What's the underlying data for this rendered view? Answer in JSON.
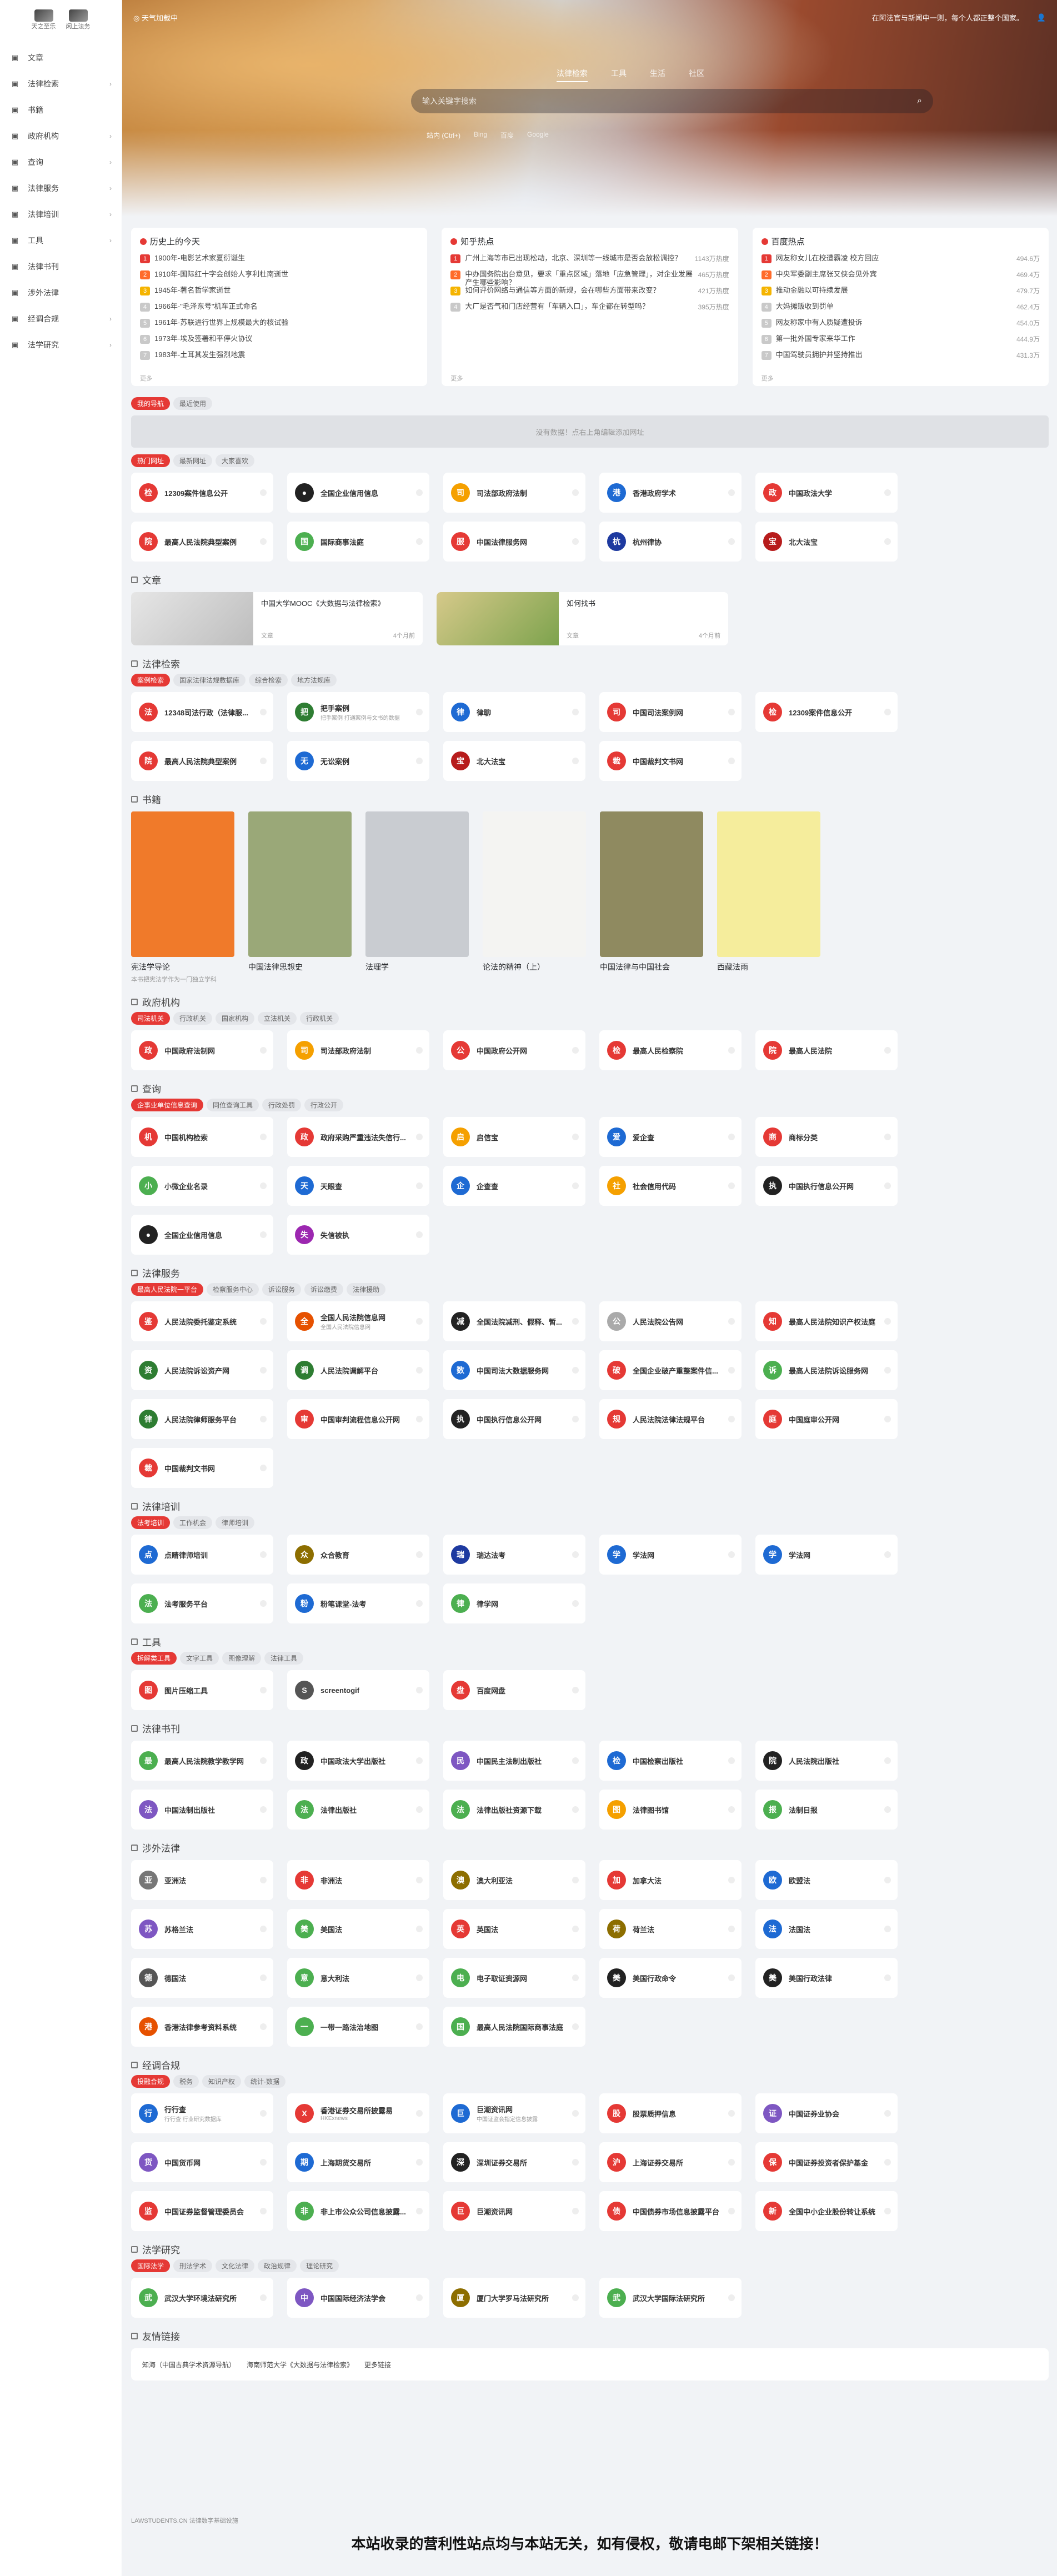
{
  "logo": {
    "left": "天之至乐",
    "right": "闲上法务"
  },
  "sidebar": [
    {
      "label": "文章",
      "icon": "article-icon",
      "chev": false
    },
    {
      "label": "法律检索",
      "icon": "scale-icon",
      "chev": true
    },
    {
      "label": "书籍",
      "icon": "book-icon",
      "chev": false
    },
    {
      "label": "政府机构",
      "icon": "government-icon",
      "chev": true
    },
    {
      "label": "查询",
      "icon": "search-icon",
      "chev": true
    },
    {
      "label": "法律服务",
      "icon": "service-icon",
      "chev": true
    },
    {
      "label": "法律培训",
      "icon": "training-icon",
      "chev": true
    },
    {
      "label": "工具",
      "icon": "tool-icon",
      "chev": true
    },
    {
      "label": "法律书刊",
      "icon": "journal-icon",
      "chev": false
    },
    {
      "label": "涉外法律",
      "icon": "globe-icon",
      "chev": false
    },
    {
      "label": "经调合规",
      "icon": "compliance-icon",
      "chev": true
    },
    {
      "label": "法学研究",
      "icon": "research-icon",
      "chev": true
    }
  ],
  "hero": {
    "tools": [
      "◎ 天气加载中"
    ],
    "news": "在阿法官与新闻中一则，每个人都正整个国家。",
    "tabs": [
      "法律检索",
      "工具",
      "生活",
      "社区"
    ],
    "placeholder": "输入关键字搜索",
    "engines": [
      "站内 (Ctrl+)",
      "Bing",
      "百度",
      "Google"
    ]
  },
  "hot": [
    {
      "title": "历史上的今天",
      "foot": "更多",
      "items": [
        {
          "t": "1900年-电影艺术家夏衍诞生",
          "v": ""
        },
        {
          "t": "1910年-国际红十字会创始人亨利杜南逝世",
          "v": ""
        },
        {
          "t": "1945年-著名哲学家逝世",
          "v": ""
        },
        {
          "t": "1966年-\"毛泽东号\"机车正式命名",
          "v": ""
        },
        {
          "t": "1961年-苏联进行世界上规模最大的核试验",
          "v": ""
        },
        {
          "t": "1973年-埃及签署和平停火协议",
          "v": ""
        },
        {
          "t": "1983年-土耳其发生强烈地震",
          "v": ""
        }
      ]
    },
    {
      "title": "知乎热点",
      "foot": "更多",
      "items": [
        {
          "t": "广州上海等市已出现松动，北京、深圳等一线城市是否会放松调控？",
          "v": "1143万热度"
        },
        {
          "t": "中办国务院出台意见，要求「重点区域」落地「应急管理」，对企业发展产生哪些影响？",
          "v": "465万热度"
        },
        {
          "t": "如何评价网络与通信等方面的新规，会在哪些方面带来改变？",
          "v": "421万热度"
        },
        {
          "t": "大厂是否气和门店经营有「车辆入口」，车企都在转型吗？",
          "v": "395万热度"
        }
      ]
    },
    {
      "title": "百度热点",
      "foot": "更多",
      "items": [
        {
          "t": "网友称女儿在校遭霸凌 校方回应",
          "v": "494.6万"
        },
        {
          "t": "中央军委副主席张又侠会见外宾",
          "v": "469.4万"
        },
        {
          "t": "推动金融以可持续发展",
          "v": "479.7万"
        },
        {
          "t": "大妈摊贩收到罚单",
          "v": "462.4万"
        },
        {
          "t": "网友称家中有人质疑遭投诉",
          "v": "454.0万"
        },
        {
          "t": "第一批外国专家来华工作",
          "v": "444.9万"
        },
        {
          "t": "中国驾驶员拥护并坚持推出",
          "v": "431.3万"
        }
      ]
    }
  ],
  "myNav": {
    "tabs": [
      "我的导航",
      "最近使用"
    ],
    "empty": "没有数据！点右上角编辑添加网址",
    "side": "编辑"
  },
  "hotSites": {
    "tabs": [
      "热门网址",
      "最新网址",
      "大家喜欢"
    ],
    "items": [
      {
        "n": "12309案件信息公开",
        "c": "#e53935",
        "i": "检"
      },
      {
        "n": "全国企业信用信息",
        "c": "#222",
        "i": "●"
      },
      {
        "n": "司法部政府法制",
        "c": "#f5a000",
        "i": "司"
      },
      {
        "n": "香港政府学术",
        "c": "#1e6ad3",
        "i": "港"
      },
      {
        "n": "中国政法大学",
        "c": "#e53935",
        "i": "政"
      },
      {
        "n": "最高人民法院典型案例",
        "c": "#e53935",
        "i": "院"
      },
      {
        "n": "国际商事法庭",
        "c": "#4caf50",
        "i": "国"
      },
      {
        "n": "中国法律服务网",
        "c": "#e53935",
        "i": "服"
      },
      {
        "n": "杭州律协",
        "c": "#1e3aa0",
        "i": "杭"
      },
      {
        "n": "北大法宝",
        "c": "#b71c1c",
        "i": "宝"
      }
    ]
  },
  "article": {
    "title": "文章",
    "posts": [
      {
        "t": "中国大学MOOC《大数据与法律检索》",
        "m": "文章",
        "d": "4个月前"
      },
      {
        "t": "如何找书",
        "m": "文章",
        "d": "4个月前"
      }
    ]
  },
  "lawSearch": {
    "title": "法律检索",
    "tabs": [
      "案例检索",
      "国家法律法规数据库",
      "综合检索",
      "地方法规库"
    ],
    "items": [
      {
        "n": "12348司法行政（法律服...",
        "c": "#e53935",
        "i": "法"
      },
      {
        "n": "把手案例",
        "c": "#2e7d32",
        "i": "把",
        "s": "把手案例 打通案例与文书的数据"
      },
      {
        "n": "律聊",
        "c": "#1e6ad3",
        "i": "律"
      },
      {
        "n": "中国司法案例网",
        "c": "#e53935",
        "i": "司"
      },
      {
        "n": "12309案件信息公开",
        "c": "#e53935",
        "i": "检"
      },
      {
        "n": "最高人民法院典型案例",
        "c": "#e53935",
        "i": "院"
      },
      {
        "n": "无讼案例",
        "c": "#1e6ad3",
        "i": "无"
      },
      {
        "n": "北大法宝",
        "c": "#b71c1c",
        "i": "宝"
      },
      {
        "n": "中国裁判文书网",
        "c": "#e53935",
        "i": "裁"
      }
    ]
  },
  "books": {
    "title": "书籍",
    "items": [
      {
        "t": "宪法学导论",
        "d": "本书把宪法学作为一门独立学科",
        "bg": "#f07a2a"
      },
      {
        "t": "中国法律思想史",
        "d": "",
        "bg": "#9aa878"
      },
      {
        "t": "法理学",
        "d": "",
        "bg": "#c9ccd1"
      },
      {
        "t": "论法的精神（上）",
        "d": "",
        "bg": "#f4f4f2"
      },
      {
        "t": "中国法律与中国社会",
        "d": "",
        "bg": "#8f8a60"
      },
      {
        "t": "西藏法雨",
        "d": "",
        "bg": "#f5ed9c"
      }
    ]
  },
  "gov": {
    "title": "政府机构",
    "tabs": [
      "司法机关",
      "行政机关",
      "国家机构",
      "立法机关",
      "行政机关"
    ],
    "items": [
      {
        "n": "中国政府法制网",
        "c": "#e53935",
        "i": "政"
      },
      {
        "n": "司法部政府法制",
        "c": "#f5a000",
        "i": "司"
      },
      {
        "n": "中国政府公开网",
        "c": "#e53935",
        "i": "公"
      },
      {
        "n": "最高人民检察院",
        "c": "#e53935",
        "i": "检"
      },
      {
        "n": "最高人民法院",
        "c": "#e53935",
        "i": "院"
      }
    ]
  },
  "query": {
    "title": "查询",
    "tabs": [
      "企事业单位信息查询",
      "同位查询工具",
      "行政处罚",
      "行政公开"
    ],
    "items": [
      {
        "n": "中国机构检索",
        "c": "#e53935",
        "i": "机"
      },
      {
        "n": "政府采购严重违法失信行...",
        "c": "#e53935",
        "i": "政"
      },
      {
        "n": "启信宝",
        "c": "#f5a000",
        "i": "启"
      },
      {
        "n": "爱企查",
        "c": "#1e6ad3",
        "i": "爱"
      },
      {
        "n": "商标分类",
        "c": "#e53935",
        "i": "商"
      },
      {
        "n": "小微企业名录",
        "c": "#4caf50",
        "i": "小"
      },
      {
        "n": "天眼查",
        "c": "#1e6ad3",
        "i": "天"
      },
      {
        "n": "企查查",
        "c": "#1e6ad3",
        "i": "企"
      },
      {
        "n": "社会信用代码",
        "c": "#f5a000",
        "i": "社"
      },
      {
        "n": "中国执行信息公开网",
        "c": "#222",
        "i": "执"
      },
      {
        "n": "全国企业信用信息",
        "c": "#222",
        "i": "●"
      },
      {
        "n": "失信被执",
        "c": "#9c27b0",
        "i": "失"
      }
    ]
  },
  "service": {
    "title": "法律服务",
    "tabs": [
      "最高人民法院一平台",
      "检察服务中心",
      "诉讼服务",
      "诉讼缴费",
      "法律援助"
    ],
    "items": [
      {
        "n": "人民法院委托鉴定系统",
        "c": "#e53935",
        "i": "鉴"
      },
      {
        "n": "全国人民法院信息网",
        "c": "#e65100",
        "i": "全",
        "s": "全国人民法院信息网"
      },
      {
        "n": "全国法院减刑、假释、暂...",
        "c": "#222",
        "i": "减"
      },
      {
        "n": "人民法院公告网",
        "c": "#aaa",
        "i": "公"
      },
      {
        "n": "最高人民法院知识产权法庭",
        "c": "#e53935",
        "i": "知"
      },
      {
        "n": "人民法院诉讼资产网",
        "c": "#2e7d32",
        "i": "资"
      },
      {
        "n": "人民法院调解平台",
        "c": "#2e7d32",
        "i": "调"
      },
      {
        "n": "中国司法大数据服务网",
        "c": "#1e6ad3",
        "i": "数"
      },
      {
        "n": "全国企业破产重整案件信...",
        "c": "#e53935",
        "i": "破"
      },
      {
        "n": "最高人民法院诉讼服务网",
        "c": "#4caf50",
        "i": "诉"
      },
      {
        "n": "人民法院律师服务平台",
        "c": "#2e7d32",
        "i": "律"
      },
      {
        "n": "中国审判流程信息公开网",
        "c": "#e53935",
        "i": "审"
      },
      {
        "n": "中国执行信息公开网",
        "c": "#222",
        "i": "执"
      },
      {
        "n": "人民法院法律法规平台",
        "c": "#e53935",
        "i": "规"
      },
      {
        "n": "中国庭审公开网",
        "c": "#e53935",
        "i": "庭"
      },
      {
        "n": "中国裁判文书网",
        "c": "#e53935",
        "i": "裁"
      }
    ]
  },
  "training": {
    "title": "法律培训",
    "tabs": [
      "法考培训",
      "工作机会",
      "律师培训"
    ],
    "items": [
      {
        "n": "点睛律师培训",
        "c": "#1e6ad3",
        "i": "点"
      },
      {
        "n": "众合教育",
        "c": "#8d6e00",
        "i": "众"
      },
      {
        "n": "瑞达法考",
        "c": "#1e3aa0",
        "i": "瑞"
      },
      {
        "n": "学法网",
        "c": "#1e6ad3",
        "i": "学"
      },
      {
        "n": "学法网",
        "c": "#1e6ad3",
        "i": "学"
      },
      {
        "n": "法考服务平台",
        "c": "#4caf50",
        "i": "法"
      },
      {
        "n": "粉笔课堂-法考",
        "c": "#1e6ad3",
        "i": "粉"
      },
      {
        "n": "律学网",
        "c": "#4caf50",
        "i": "律"
      }
    ]
  },
  "tools": {
    "title": "工具",
    "tabs": [
      "拆解类工具",
      "文字工具",
      "图像理解",
      "法律工具"
    ],
    "items": [
      {
        "n": "图片压缩工具",
        "c": "#e53935",
        "i": "图"
      },
      {
        "n": "screentogif",
        "c": "#555",
        "i": "S"
      },
      {
        "n": "百度网盘",
        "c": "#e53935",
        "i": "盘"
      }
    ]
  },
  "journals": {
    "title": "法律书刊",
    "items": [
      {
        "n": "最高人民法院教学教学网",
        "c": "#4caf50",
        "i": "最"
      },
      {
        "n": "中国政法大学出版社",
        "c": "#222",
        "i": "政"
      },
      {
        "n": "中国民主法制出版社",
        "c": "#7e57c2",
        "i": "民"
      },
      {
        "n": "中国检察出版社",
        "c": "#1e6ad3",
        "i": "检"
      },
      {
        "n": "人民法院出版社",
        "c": "#222",
        "i": "院"
      },
      {
        "n": "中国法制出版社",
        "c": "#7e57c2",
        "i": "法"
      },
      {
        "n": "法律出版社",
        "c": "#4caf50",
        "i": "法"
      },
      {
        "n": "法律出版社资源下载",
        "c": "#4caf50",
        "i": "法"
      },
      {
        "n": "法律图书馆",
        "c": "#f5a000",
        "i": "图"
      },
      {
        "n": "法制日报",
        "c": "#4caf50",
        "i": "报"
      }
    ]
  },
  "foreign": {
    "title": "涉外法律",
    "items": [
      {
        "n": "亚洲法",
        "c": "#777",
        "i": "亚"
      },
      {
        "n": "非洲法",
        "c": "#e53935",
        "i": "非"
      },
      {
        "n": "澳大利亚法",
        "c": "#8d6e00",
        "i": "澳"
      },
      {
        "n": "加拿大法",
        "c": "#e53935",
        "i": "加"
      },
      {
        "n": "欧盟法",
        "c": "#1e6ad3",
        "i": "欧"
      },
      {
        "n": "苏格兰法",
        "c": "#7e57c2",
        "i": "苏"
      },
      {
        "n": "美国法",
        "c": "#4caf50",
        "i": "美"
      },
      {
        "n": "英国法",
        "c": "#e53935",
        "i": "英"
      },
      {
        "n": "荷兰法",
        "c": "#8d6e00",
        "i": "荷"
      },
      {
        "n": "法国法",
        "c": "#1e6ad3",
        "i": "法"
      },
      {
        "n": "德国法",
        "c": "#555",
        "i": "德"
      },
      {
        "n": "意大利法",
        "c": "#4caf50",
        "i": "意"
      },
      {
        "n": "电子取证资源网",
        "c": "#4caf50",
        "i": "电"
      },
      {
        "n": "美国行政命令",
        "c": "#222",
        "i": "美"
      },
      {
        "n": "美国行政法律",
        "c": "#222",
        "i": "美"
      },
      {
        "n": "香港法律参考资料系统",
        "c": "#e65100",
        "i": "港"
      },
      {
        "n": "一带一路法治地图",
        "c": "#4caf50",
        "i": "一"
      },
      {
        "n": "最高人民法院国际商事法庭",
        "c": "#4caf50",
        "i": "国"
      }
    ]
  },
  "compliance": {
    "title": "经调合规",
    "tabs": [
      "投融合规",
      "税务",
      "知识产权",
      "统计·数据"
    ],
    "items": [
      {
        "n": "行行查",
        "c": "#1e6ad3",
        "i": "行",
        "s": "行行查 行业研究数据库"
      },
      {
        "n": "香港证券交易所披露易",
        "c": "#e53935",
        "i": "X",
        "s": "HKExnews"
      },
      {
        "n": "巨潮资讯网",
        "c": "#1e6ad3",
        "i": "巨",
        "s": "中国证监会指定信息披露"
      },
      {
        "n": "股票质押信息",
        "c": "#e53935",
        "i": "股"
      },
      {
        "n": "中国证券业协会",
        "c": "#7e57c2",
        "i": "证"
      },
      {
        "n": "中国货币网",
        "c": "#7e57c2",
        "i": "货"
      },
      {
        "n": "上海期货交易所",
        "c": "#1e6ad3",
        "i": "期"
      },
      {
        "n": "深圳证券交易所",
        "c": "#222",
        "i": "深"
      },
      {
        "n": "上海证券交易所",
        "c": "#e53935",
        "i": "沪"
      },
      {
        "n": "中国证券投资者保护基金",
        "c": "#e53935",
        "i": "保"
      },
      {
        "n": "中国证券监督管理委员会",
        "c": "#e53935",
        "i": "监"
      },
      {
        "n": "非上市公众公司信息披露...",
        "c": "#4caf50",
        "i": "非"
      },
      {
        "n": "巨潮资讯网",
        "c": "#e53935",
        "i": "巨"
      },
      {
        "n": "中国债券市场信息披露平台",
        "c": "#e53935",
        "i": "债"
      },
      {
        "n": "全国中小企业股份转让系统",
        "c": "#e53935",
        "i": "新"
      }
    ]
  },
  "research": {
    "title": "法学研究",
    "tabs": [
      "国际法学",
      "刑法学术",
      "文化法律",
      "政治规律",
      "理论研究"
    ],
    "items": [
      {
        "n": "武汉大学环境法研究所",
        "c": "#4caf50",
        "i": "武"
      },
      {
        "n": "中国国际经济法学会",
        "c": "#7e57c2",
        "i": "中"
      },
      {
        "n": "厦门大学罗马法研究所",
        "c": "#8d6e00",
        "i": "厦"
      },
      {
        "n": "武汉大学国际法研究所",
        "c": "#4caf50",
        "i": "武"
      }
    ]
  },
  "friends": {
    "title": "友情链接",
    "links": [
      "知海（中国古典学术资源导航）",
      "海南师范大学《大数据与法律检索》",
      "更多链接"
    ]
  },
  "footer": "LAWSTUDENTS.CN 法律数字基础设施",
  "banner": "本站收录的营利性站点均与本站无关，如有侵权，敬请电邮下架相关链接！",
  "colors": {
    "accent": "#e53935"
  }
}
